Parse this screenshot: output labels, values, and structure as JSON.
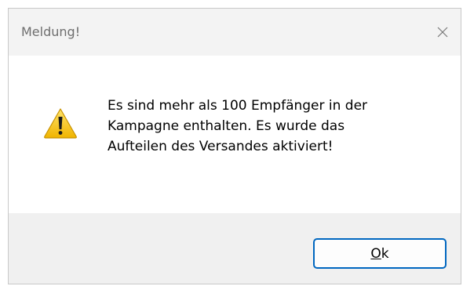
{
  "dialog": {
    "title": "Meldung!",
    "close_glyph": "✕",
    "icon": "warning-icon",
    "message_lines": [
      "Es sind mehr als 100 Empfänger in der",
      "Kampagne enthalten. Es wurde das",
      "Aufteilen des Versandes aktiviert!"
    ],
    "ok_button": {
      "mnemonic": "O",
      "rest": "k"
    }
  },
  "colors": {
    "accent": "#0067c0",
    "warning_fill": "#f5c400",
    "title_text": "#6e6e6e"
  }
}
